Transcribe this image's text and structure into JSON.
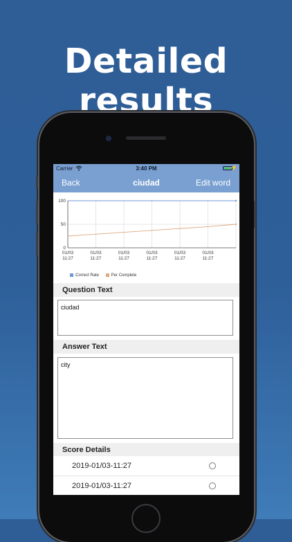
{
  "headline": "Detailed results",
  "status_bar": {
    "carrier": "Carrier",
    "time": "3:40 PM",
    "wifi_icon": "wifi-icon",
    "battery_icon": "battery-icon"
  },
  "nav": {
    "back_label": "Back",
    "title": "ciudad",
    "edit_label": "Edit word",
    "bar_color": "#7aa0d1"
  },
  "chart_data": {
    "type": "line",
    "x": [
      "01/03 11:27",
      "01/03 11:27",
      "01/03 11:27",
      "01/03 11:27",
      "01/03 11:27",
      "01/03 11:27"
    ],
    "x_tick_lines": [
      [
        "01/03",
        "11:27"
      ],
      [
        "01/03",
        "11:27"
      ],
      [
        "01/03",
        "11:27"
      ],
      [
        "01/03",
        "11:27"
      ],
      [
        "01/03",
        "11:27"
      ],
      [
        "01/03",
        "11:27"
      ]
    ],
    "series": [
      {
        "name": "Correct Rate",
        "color": "#6f97d6",
        "values": [
          100,
          100,
          100,
          100,
          100,
          100,
          100
        ]
      },
      {
        "name": "Per Complete",
        "color": "#e0a77c",
        "values": [
          25,
          29,
          33,
          37,
          41,
          45,
          50
        ]
      }
    ],
    "y_ticks": [
      "100",
      "50",
      "0"
    ],
    "ylim": [
      0,
      100
    ],
    "grid": true,
    "legend_position": "bottom-left"
  },
  "question": {
    "header": "Question Text",
    "text": "ciudad"
  },
  "answer": {
    "header": "Answer Text",
    "text": "city"
  },
  "score": {
    "header": "Score Details",
    "rows": [
      {
        "date": "2019-01/03-11:27"
      },
      {
        "date": "2019-01/03-11:27"
      }
    ]
  }
}
